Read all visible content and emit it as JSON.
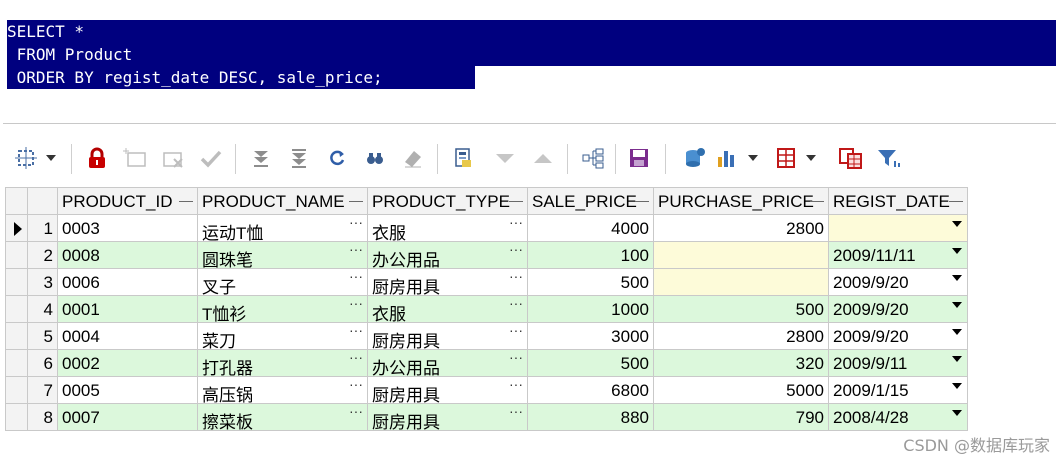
{
  "sql": {
    "lines": [
      "SELECT *",
      " FROM Product",
      " ORDER BY regist_date DESC, sale_price;"
    ]
  },
  "grid": {
    "columns": [
      "PRODUCT_ID",
      "PRODUCT_NAME",
      "PRODUCT_TYPE",
      "SALE_PRICE",
      "PURCHASE_PRICE",
      "REGIST_DATE"
    ],
    "rows": [
      {
        "num": "1",
        "id": "0003",
        "name": "运动T恤",
        "type": "衣服",
        "sale": "4000",
        "purchase": "2800",
        "date": ""
      },
      {
        "num": "2",
        "id": "0008",
        "name": "圆珠笔",
        "type": "办公用品",
        "sale": "100",
        "purchase": "",
        "date": "2009/11/11"
      },
      {
        "num": "3",
        "id": "0006",
        "name": "叉子",
        "type": "厨房用具",
        "sale": "500",
        "purchase": "",
        "date": "2009/9/20"
      },
      {
        "num": "4",
        "id": "0001",
        "name": "T恤衫",
        "type": "衣服",
        "sale": "1000",
        "purchase": "500",
        "date": "2009/9/20"
      },
      {
        "num": "5",
        "id": "0004",
        "name": "菜刀",
        "type": "厨房用具",
        "sale": "3000",
        "purchase": "2800",
        "date": "2009/9/20"
      },
      {
        "num": "6",
        "id": "0002",
        "name": "打孔器",
        "type": "办公用品",
        "sale": "500",
        "purchase": "320",
        "date": "2009/9/11"
      },
      {
        "num": "7",
        "id": "0005",
        "name": "高压锅",
        "type": "厨房用具",
        "sale": "6800",
        "purchase": "5000",
        "date": "2009/1/15"
      },
      {
        "num": "8",
        "id": "0007",
        "name": "擦菜板",
        "type": "厨房用具",
        "sale": "880",
        "purchase": "790",
        "date": "2008/4/28"
      }
    ],
    "ellipsis": "···"
  },
  "watermark": "CSDN @数据库玩家",
  "colors": {
    "selection": "#00007f",
    "alt_row": "#dcf8dc",
    "null_cell": "#fdfbd9"
  },
  "toolbar_icons": [
    "select-mode-icon",
    "lock-icon",
    "insert-record-icon",
    "delete-record-icon",
    "post-edit-icon",
    "clear-filter-icon",
    "filter-icon",
    "refresh-icon",
    "find-icon",
    "eraser-icon",
    "query-by-example-icon",
    "sort-down-icon",
    "sort-up-icon",
    "tree-view-icon",
    "save-icon",
    "database-icon",
    "chart-icon",
    "grid-icon",
    "export-icon",
    "funnel-icon"
  ]
}
